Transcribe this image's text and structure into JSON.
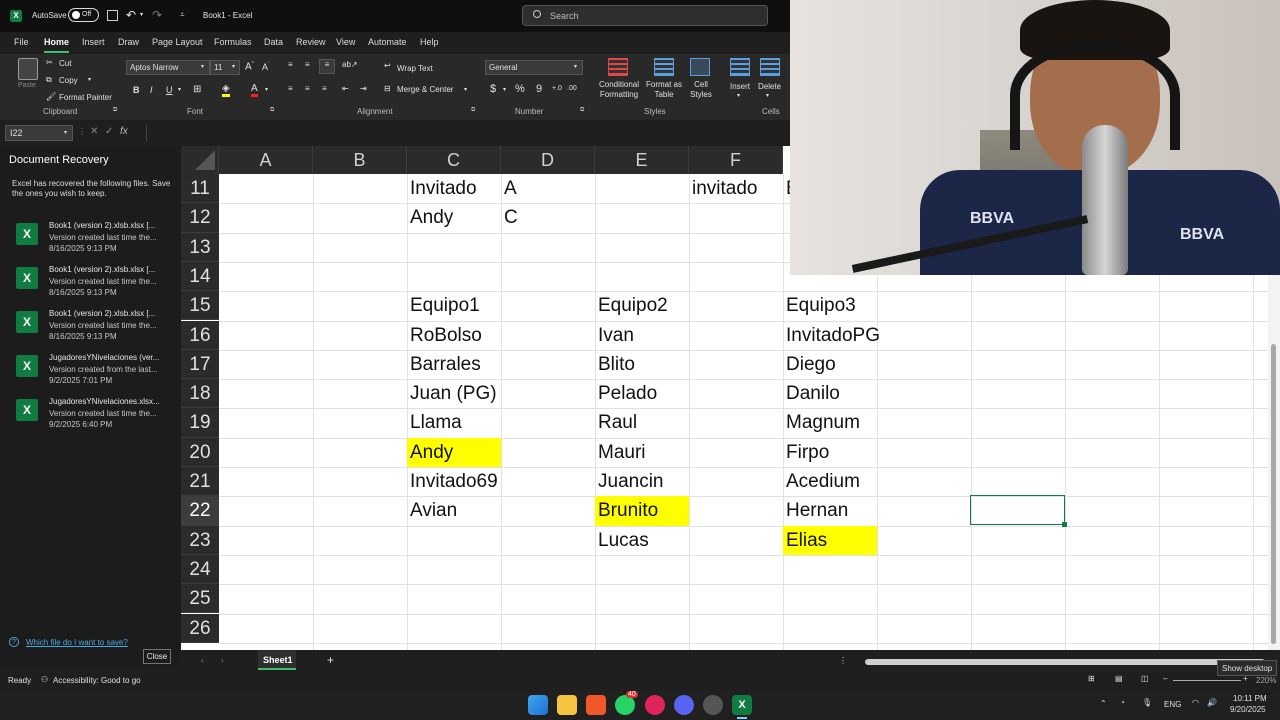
{
  "titlebar": {
    "autosave_label": "AutoSave",
    "autosave_state": "Off",
    "doc_title": "Book1 - Excel",
    "search_placeholder": "Search"
  },
  "menu": [
    "File",
    "Home",
    "Insert",
    "Draw",
    "Page Layout",
    "Formulas",
    "Data",
    "Review",
    "View",
    "Automate",
    "Help"
  ],
  "ribbon": {
    "clipboard": {
      "paste": "Paste",
      "cut": "Cut",
      "copy": "Copy",
      "format_painter": "Format Painter",
      "label": "Clipboard"
    },
    "font": {
      "name": "Aptos Narrow",
      "size": "11",
      "bold": "B",
      "italic": "I",
      "underline": "U",
      "label": "Font"
    },
    "alignment": {
      "wrap": "Wrap Text",
      "merge": "Merge & Center",
      "label": "Alignment"
    },
    "number": {
      "format": "General",
      "currency": "$",
      "percent": "%",
      "comma": "9",
      "label": "Number"
    },
    "styles": {
      "conditional": "Conditional Formatting",
      "format_table": "Format as Table",
      "cell_styles": "Cell Styles",
      "label": "Styles"
    },
    "cells": {
      "insert": "Insert",
      "delete": "Delete",
      "label": "Cells"
    }
  },
  "formula_bar": {
    "name_box": "I22",
    "fx": "fx",
    "value": ""
  },
  "recovery": {
    "title": "Document Recovery",
    "description": "Excel has recovered the following files.  Save the ones you wish to keep.",
    "items": [
      {
        "name": "Book1 (version 2).xlsb.xlsx  [...",
        "status": "Version created last time the...",
        "date": "8/16/2025 9:13 PM"
      },
      {
        "name": "Book1 (version 2).xlsb.xlsx  [...",
        "status": "Version created last time the...",
        "date": "8/16/2025 9:13 PM"
      },
      {
        "name": "Book1 (version 2).xlsb.xlsx  [...",
        "status": "Version created last time the...",
        "date": "8/16/2025 9:13 PM"
      },
      {
        "name": "JugadoresYNivelaciones (ver...",
        "status": "Version created from the last...",
        "date": "9/2/2025 7:01 PM"
      },
      {
        "name": "JugadoresYNivelaciones.xlsx...",
        "status": "Version created last time the...",
        "date": "9/2/2025 6:40 PM"
      }
    ],
    "help_link": "Which file do I want to save?",
    "close": "Close"
  },
  "grid": {
    "columns": [
      "A",
      "B",
      "C",
      "D",
      "E",
      "F"
    ],
    "rows": [
      "11",
      "12",
      "13",
      "14",
      "15",
      "16",
      "17",
      "18",
      "19",
      "20",
      "21",
      "22",
      "23",
      "24",
      "25",
      "26"
    ],
    "selected_row": "22",
    "cells": {
      "C11": "Invitado",
      "D11": "A",
      "F11": "invitado",
      "G11": "B",
      "C12": "Andy",
      "D12": "C",
      "C15": "Equipo1",
      "E15": "Equipo2",
      "G15": "Equipo3",
      "C16": "RoBolso",
      "E16": "Ivan",
      "G16": "InvitadoPG",
      "C17": "Barrales",
      "E17": "Blito",
      "G17": "Diego",
      "C18": "Juan (PG)",
      "E18": "Pelado",
      "G18": "Danilo",
      "C19": "Llama",
      "E19": "Raul",
      "G19": "Magnum",
      "C20": "Andy",
      "E20": "Mauri",
      "G20": "Firpo",
      "C21": "Invitado69",
      "E21": "Juancin",
      "G21": "Acedium",
      "C22": "Avian",
      "E22": "Brunito",
      "G22": "Hernan",
      "E23": "Lucas",
      "G23": "Elias"
    },
    "highlight_color": "#ffff00"
  },
  "sheets": {
    "active": "Sheet1",
    "add": "+"
  },
  "status": {
    "ready": "Ready",
    "accessibility": "Accessibility: Good to go",
    "zoom": "220%",
    "show_desktop": "Show desktop"
  },
  "taskbar": {
    "lang": "ENG",
    "time": "10:11 PM",
    "date": "9/20/2025",
    "whatsapp_badge": "40"
  },
  "webcam": {
    "jersey_text_left": "BBVA",
    "jersey_text_right": "BBVA"
  }
}
